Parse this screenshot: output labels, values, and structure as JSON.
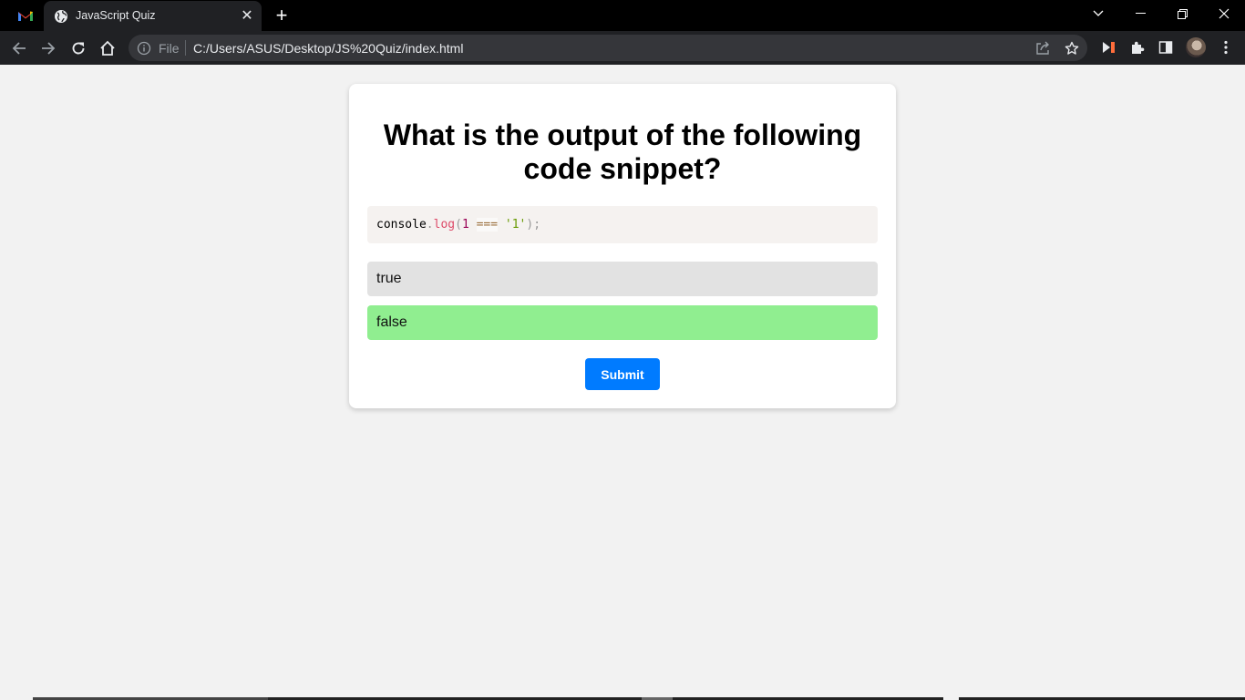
{
  "browser": {
    "tab": {
      "title": "JavaScript Quiz",
      "close_glyph": "✕"
    },
    "new_tab_glyph": "+",
    "address": {
      "scheme_label": "File",
      "url": "C:/Users/ASUS/Desktop/JS%20Quiz/index.html"
    },
    "icons": [
      "gmail-icon",
      "globe-icon",
      "back-icon",
      "forward-icon",
      "reload-icon",
      "home-icon",
      "info-icon",
      "share-icon",
      "star-icon",
      "extension-icon",
      "puzzle-icon",
      "side-panel-icon",
      "avatar",
      "menu-icon"
    ]
  },
  "quiz": {
    "question": "What is the output of the following code snippet?",
    "code": {
      "obj": "console",
      "dot": ".",
      "fn": "log",
      "open": "(",
      "num": "1",
      "op": "===",
      "str": "'1'",
      "close": ");"
    },
    "options": [
      {
        "label": "true",
        "selected": false
      },
      {
        "label": "false",
        "selected": true
      }
    ],
    "submit_label": "Submit"
  },
  "colors": {
    "page_bg": "#f2f2f2",
    "selected_option": "#90ee90",
    "option_bg": "#e2e2e2",
    "submit_bg": "#007bff",
    "code_bg": "#f5f2f0"
  }
}
